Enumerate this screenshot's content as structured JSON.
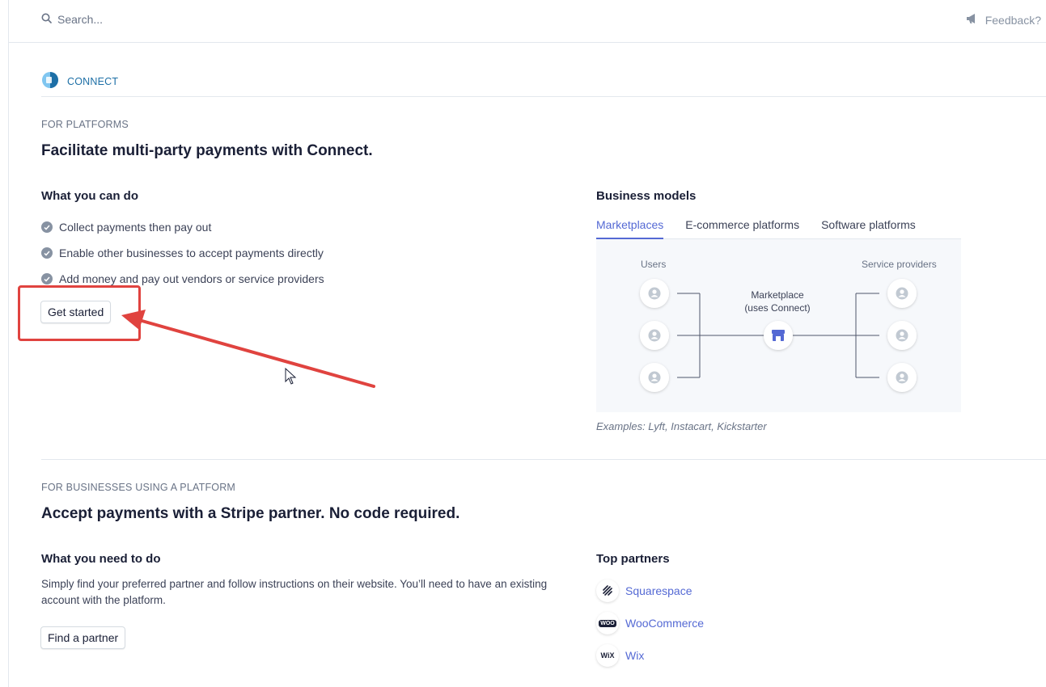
{
  "topbar": {
    "search_placeholder": "Search...",
    "feedback_label": "Feedback?"
  },
  "breadcrumb": {
    "label": "CONNECT"
  },
  "platforms": {
    "eyebrow": "FOR PLATFORMS",
    "title": "Facilitate multi-party payments with Connect.",
    "what_you_can_do": {
      "heading": "What you can do",
      "items": [
        "Collect payments then pay out",
        "Enable other businesses to accept payments directly",
        "Add money and pay out vendors or service providers"
      ]
    },
    "get_started_label": "Get started",
    "business_models": {
      "heading": "Business models",
      "tabs": [
        {
          "label": "Marketplaces",
          "active": true
        },
        {
          "label": "E-commerce platforms",
          "active": false
        },
        {
          "label": "Software platforms",
          "active": false
        }
      ],
      "diagram": {
        "left_label": "Users",
        "right_label": "Service providers",
        "center_line1": "Marketplace",
        "center_line2": "(uses Connect)"
      },
      "examples": "Examples: Lyft, Instacart, Kickstarter"
    }
  },
  "businesses": {
    "eyebrow": "FOR BUSINESSES USING A PLATFORM",
    "title": "Accept payments with a Stripe partner. No code required.",
    "what_you_need": {
      "heading": "What you need to do",
      "description": "Simply find your preferred partner and follow instructions on their website. You’ll need to have an existing account with the platform."
    },
    "find_partner_label": "Find a partner",
    "top_partners": {
      "heading": "Top partners",
      "items": [
        {
          "name": "Squarespace",
          "icon": "squarespace-logo-icon"
        },
        {
          "name": "WooCommerce",
          "icon": "woocommerce-logo-icon",
          "logo_text": "WOO"
        },
        {
          "name": "Wix",
          "icon": "wix-logo-icon",
          "logo_text": "WiX"
        }
      ]
    }
  },
  "annotation": {
    "color": "#e0433f"
  },
  "colors": {
    "accent": "#5469d4",
    "link": "#1d6fa6",
    "text": "#1a1f36",
    "muted": "#697386"
  }
}
